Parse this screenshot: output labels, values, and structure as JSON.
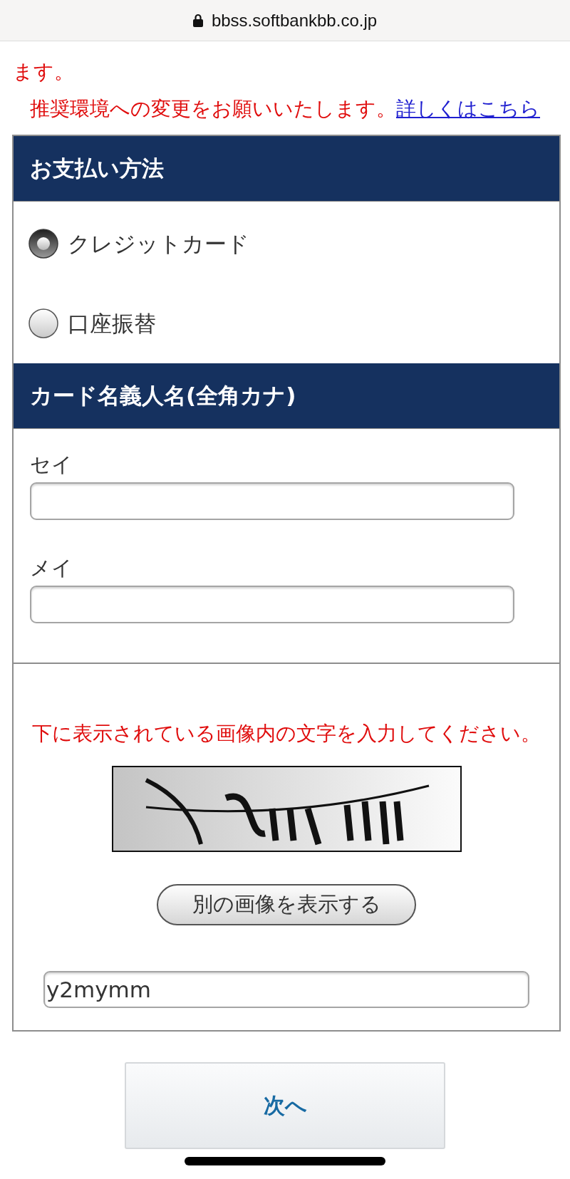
{
  "address_bar": {
    "url": "bbss.softbankbb.co.jp"
  },
  "notice": {
    "text": "ます。",
    "request": "推奨環境への変更をお願いいたします。",
    "link": "詳しくはこちら"
  },
  "sections": [
    {
      "kind": "radio",
      "title": "お支払い方法",
      "options": [
        {
          "label": "クレジットカード",
          "selected": true
        },
        {
          "label": "口座振替",
          "selected": false
        }
      ]
    },
    {
      "kind": "fields",
      "title": "カード名義人名(全角カナ)",
      "fields": [
        {
          "label": "セイ"
        },
        {
          "label": "メイ"
        }
      ]
    },
    {
      "kind": "captcha",
      "instruction": "下に表示されている画像内の文字を入力してください。",
      "refresh_button": "別の画像を表示する",
      "answer": {
        "value": "y2mymm"
      }
    }
  ],
  "next_button": {
    "label": "次へ"
  }
}
